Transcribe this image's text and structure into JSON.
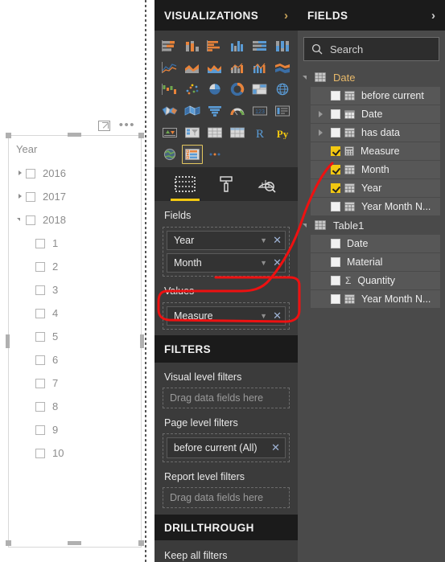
{
  "canvas": {
    "visual_toolbar": {
      "focus_icon": "focus-mode-icon",
      "more_icon": "more-options-icon"
    },
    "slicer": {
      "title": "Year",
      "items": [
        {
          "label": "2016",
          "state": "collapsed",
          "level": 0,
          "checked": false
        },
        {
          "label": "2017",
          "state": "collapsed",
          "level": 0,
          "checked": false
        },
        {
          "label": "2018",
          "state": "expanded",
          "level": 0,
          "checked": false
        },
        {
          "label": "1",
          "state": "leaf",
          "level": 1,
          "checked": false
        },
        {
          "label": "2",
          "state": "leaf",
          "level": 1,
          "checked": false
        },
        {
          "label": "3",
          "state": "leaf",
          "level": 1,
          "checked": false
        },
        {
          "label": "4",
          "state": "leaf",
          "level": 1,
          "checked": false
        },
        {
          "label": "5",
          "state": "leaf",
          "level": 1,
          "checked": false
        },
        {
          "label": "6",
          "state": "leaf",
          "level": 1,
          "checked": false
        },
        {
          "label": "7",
          "state": "leaf",
          "level": 1,
          "checked": false
        },
        {
          "label": "8",
          "state": "leaf",
          "level": 1,
          "checked": false
        },
        {
          "label": "9",
          "state": "leaf",
          "level": 1,
          "checked": false
        },
        {
          "label": "10",
          "state": "leaf",
          "level": 1,
          "checked": false
        }
      ]
    }
  },
  "visualizations": {
    "header": {
      "title": "VISUALIZATIONS",
      "chevron": "chevron-right-icon"
    },
    "gallery": {
      "selected_index": 31,
      "icons": [
        "stacked-bar-chart",
        "stacked-column-chart",
        "clustered-bar-chart",
        "clustered-column-chart",
        "100-percent-stacked-bar-chart",
        "100-percent-stacked-column-chart",
        "line-chart",
        "area-chart",
        "stacked-area-chart",
        "line-and-stacked-column-chart",
        "line-and-clustered-column-chart",
        "ribbon-chart",
        "waterfall-chart",
        "scatter-chart",
        "pie-chart",
        "donut-chart",
        "treemap",
        "map",
        "filled-map",
        "shape-map",
        "funnel",
        "gauge",
        "card",
        "multi-row-card",
        "kpi",
        "slicer-filter",
        "table",
        "matrix",
        "r-script-visual",
        "python-visual",
        "arcgis-map",
        "slicer",
        "get-more-visuals"
      ]
    },
    "subtabs": [
      {
        "name": "fields-tab",
        "icon": "fields-icon",
        "active": true
      },
      {
        "name": "format-tab",
        "icon": "paint-roller-icon",
        "active": false
      },
      {
        "name": "analytics-tab",
        "icon": "analytics-magnifier-icon",
        "active": false
      }
    ],
    "fields_section": {
      "title": "Fields",
      "wells": [
        {
          "name": "Year",
          "dropdown": "chevron-down-icon",
          "remove": "remove-icon"
        },
        {
          "name": "Month",
          "dropdown": "chevron-down-icon",
          "remove": "remove-icon"
        }
      ]
    },
    "values_section": {
      "title": "Values",
      "wells": [
        {
          "name": "Measure",
          "dropdown": "chevron-down-icon",
          "remove": "remove-icon",
          "highlighted": true
        }
      ]
    }
  },
  "filters": {
    "header": {
      "title": "FILTERS"
    },
    "groups": [
      {
        "title": "Visual level filters",
        "placeholder": "Drag data fields here",
        "pills": []
      },
      {
        "title": "Page level filters",
        "placeholder": "Drag data fields here",
        "pills": [
          {
            "label": "before current  (All)",
            "remove": "remove-icon"
          }
        ]
      },
      {
        "title": "Report level filters",
        "placeholder": "Drag data fields here",
        "pills": []
      }
    ]
  },
  "drillthrough": {
    "header": {
      "title": "DRILLTHROUGH"
    },
    "rows": [
      {
        "label": "Keep all filters"
      }
    ]
  },
  "fields": {
    "header": {
      "title": "FIELDS",
      "chevron": "chevron-right-icon"
    },
    "search": {
      "placeholder": "Search",
      "value": "",
      "icon": "search-icon"
    },
    "tables": [
      {
        "name": "Date",
        "expanded": true,
        "highlighted": true,
        "fields": [
          {
            "name": "before current",
            "checked": false,
            "icon": "calculated-field-icon",
            "expandable": false
          },
          {
            "name": "Date",
            "checked": false,
            "icon": "date-hierarchy-icon",
            "expandable": true
          },
          {
            "name": "has data",
            "checked": false,
            "icon": "calculated-field-icon",
            "expandable": true
          },
          {
            "name": "Measure",
            "checked": true,
            "icon": "measure-icon",
            "expandable": false
          },
          {
            "name": "Month",
            "checked": true,
            "icon": "calculated-field-icon",
            "expandable": false
          },
          {
            "name": "Year",
            "checked": true,
            "icon": "calculated-field-icon",
            "expandable": false
          },
          {
            "name": "Year Month N...",
            "checked": false,
            "icon": "calculated-field-icon",
            "expandable": false
          }
        ]
      },
      {
        "name": "Table1",
        "expanded": true,
        "highlighted": false,
        "fields": [
          {
            "name": "Date",
            "checked": false,
            "icon": "none",
            "expandable": false
          },
          {
            "name": "Material",
            "checked": false,
            "icon": "none",
            "expandable": false
          },
          {
            "name": "Quantity",
            "checked": false,
            "icon": "sum-icon",
            "expandable": false
          },
          {
            "name": "Year Month N...",
            "checked": false,
            "icon": "calculated-field-icon",
            "expandable": false
          }
        ]
      }
    ]
  },
  "annotation": {
    "color": "#ee1111",
    "shapes": [
      "curve-from-measure-checkbox",
      "rectangle-around-measure-value-well"
    ]
  },
  "colors": {
    "pane_dark": "#1b1b1b",
    "viz_pane_bg": "#3b3b3b",
    "fields_pane_bg": "#4a4a4a",
    "accent_yellow": "#f2c811",
    "table_header_orange": "#e8b96a",
    "annotation_red": "#ee1111"
  }
}
